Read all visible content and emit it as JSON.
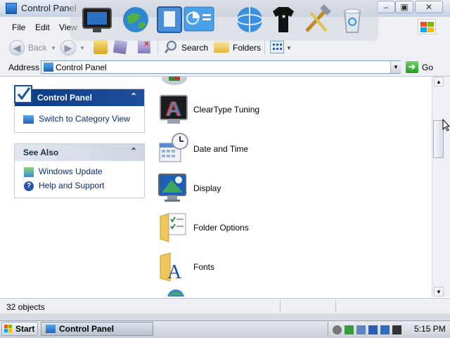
{
  "window": {
    "title": "Control Panel"
  },
  "menu": {
    "file": "File",
    "edit": "Edit",
    "view": "View"
  },
  "toolbar": {
    "back": "Back",
    "search": "Search",
    "folders": "Folders"
  },
  "address": {
    "label": "Address",
    "value": "Control Panel",
    "go": "Go"
  },
  "left": {
    "control_panel": {
      "title": "Control Panel",
      "switch_link": "Switch to Category View"
    },
    "see_also": {
      "title": "See Also",
      "items": [
        "Windows Update",
        "Help and Support"
      ]
    }
  },
  "items": [
    "ClearType Tuning",
    "Date and Time",
    "Display",
    "Folder Options",
    "Fonts"
  ],
  "status": {
    "objects": "32 objects"
  },
  "taskbar": {
    "start": "Start",
    "task": "Control Panel",
    "clock": "5:15 PM"
  },
  "colors": {
    "accent": "#0a246a",
    "panel_header": "#16407c",
    "titlebar": "#d7e0ec"
  }
}
